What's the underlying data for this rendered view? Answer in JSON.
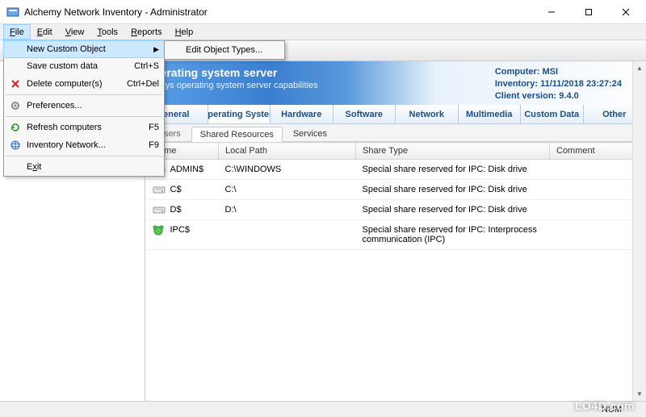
{
  "window": {
    "title": "Alchemy Network Inventory - Administrator"
  },
  "menubar": {
    "items": [
      {
        "label": "File",
        "underline": "F",
        "rest": "ile"
      },
      {
        "label": "Edit",
        "underline": "E",
        "rest": "dit"
      },
      {
        "label": "View",
        "underline": "V",
        "rest": "iew"
      },
      {
        "label": "Tools",
        "underline": "T",
        "rest": "ools"
      },
      {
        "label": "Reports",
        "underline": "R",
        "rest": "eports"
      },
      {
        "label": "Help",
        "underline": "H",
        "rest": "elp"
      }
    ]
  },
  "file_menu": {
    "items": [
      {
        "label": "New Custom Object",
        "shortcut": "",
        "has_submenu": true,
        "highlighted": true
      },
      {
        "label": "Save custom data",
        "shortcut": "Ctrl+S"
      },
      {
        "label": "Delete computer(s)",
        "shortcut": "Ctrl+Del",
        "icon": "delete"
      },
      {
        "label": "Preferences...",
        "shortcut": "",
        "icon": "prefs"
      },
      {
        "label": "Refresh computers",
        "shortcut": "F5",
        "icon": "refresh"
      },
      {
        "label": "Inventory Network...",
        "shortcut": "F9",
        "icon": "network"
      },
      {
        "label": "Exit",
        "shortcut": "",
        "underline_pos": 1
      }
    ],
    "submenu": {
      "items": [
        {
          "label": "Edit Object Types..."
        }
      ]
    }
  },
  "banner": {
    "title_partial": "perating system server",
    "subtitle_partial": "plays operating system server capabilities",
    "info": {
      "computer_label": "Computer:",
      "computer_value": "MSI",
      "inventory_label": "Inventory:",
      "inventory_value": "11/11/2018 23:27:24",
      "client_label": "Client version:",
      "client_value": "9.4.0"
    }
  },
  "category_tabs": [
    "eneral",
    "Operating System",
    "Hardware",
    "Software",
    "Network",
    "Multimedia",
    "Custom Data",
    "Other"
  ],
  "sub_tabs": {
    "partial_left": "Users",
    "items": [
      "Shared Resources",
      "Services"
    ],
    "active_index": 0
  },
  "grid": {
    "columns": [
      "Name",
      "Local Path",
      "Share Type",
      "Comment"
    ],
    "rows": [
      {
        "icon": "drive",
        "name": "ADMIN$",
        "path": "C:\\WINDOWS",
        "type": "Special share reserved for IPC: Disk drive",
        "comment": ""
      },
      {
        "icon": "drive",
        "name": "C$",
        "path": "C:\\",
        "type": "Special share reserved for IPC: Disk drive",
        "comment": ""
      },
      {
        "icon": "drive",
        "name": "D$",
        "path": "D:\\",
        "type": "Special share reserved for IPC: Disk drive",
        "comment": ""
      },
      {
        "icon": "ipc",
        "name": "IPC$",
        "path": "",
        "type": "Special share reserved for IPC: Interprocess communication (IPC)",
        "comment": ""
      }
    ]
  },
  "statusbar": {
    "num": "NUM"
  },
  "watermark": "LO4D.com"
}
